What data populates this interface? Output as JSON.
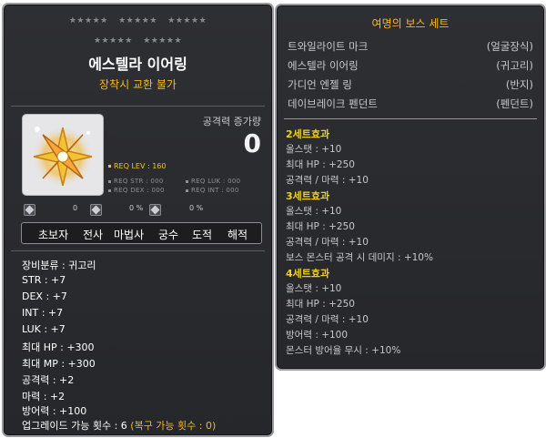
{
  "item": {
    "stars_row1": [
      "★★★★★",
      "★★★★★",
      "★★★★★"
    ],
    "stars_row2": [
      "★★★★★",
      "★★★★★"
    ],
    "name": "에스텔라 이어링",
    "note": "장착시 교환 불가",
    "attack_label": "공격력 증가량",
    "attack_value": "0",
    "req_lev": "REQ LEV : 160",
    "req_str": "REQ STR : 000",
    "req_luk": "REQ LUK : 000",
    "req_dex": "REQ DEX : 000",
    "req_int": "REQ INT : 000",
    "pct_labels": [
      "0",
      "0 %",
      "0 %",
      "0 %"
    ],
    "jobs": [
      "초보자",
      "전사",
      "마법사",
      "궁수",
      "도적",
      "해적"
    ],
    "stats": [
      "장비분류 : 귀고리",
      "STR : +7",
      "DEX : +7",
      "INT : +7",
      "LUK : +7",
      "최대 HP : +300",
      "최대 MP : +300",
      "공격력 : +2",
      "마력 : +2",
      "방어력 : +100"
    ],
    "upgrade_text": "업그레이드 가능 횟수 : 6",
    "upgrade_restore": "(복구 가능 횟수 : 0)"
  },
  "set": {
    "title": "여명의 보스 세트",
    "items": [
      {
        "name": "트와일라이트 마크",
        "category": "(얼굴장식)"
      },
      {
        "name": "에스텔라 이어링",
        "category": "(귀고리)"
      },
      {
        "name": "가디언 엔젤 링",
        "category": "(반지)"
      },
      {
        "name": "데이브레이크 펜던트",
        "category": "(펜던트)"
      }
    ],
    "effects": [
      {
        "header": "2세트효과",
        "lines": [
          "올스탯 : +10",
          "최대 HP : +250",
          "공격력 / 마력 : +10"
        ]
      },
      {
        "header": "3세트효과",
        "lines": [
          "올스탯 : +10",
          "최대 HP : +250",
          "공격력 / 마력 : +10",
          "보스 몬스터 공격 시 데미지 : +10%"
        ]
      },
      {
        "header": "4세트효과",
        "lines": [
          "올스탯 : +10",
          "최대 HP : +250",
          "공격력 / 마력 : +10",
          "방어력 : +100",
          "몬스터 방어율 무시 : +10%"
        ]
      }
    ]
  },
  "colors": {
    "panel_bg": "#2e2f33",
    "gold": "#f4b81e",
    "set_header": "#f0cf1e",
    "muted": "#c8c8cc"
  },
  "icons": [
    "earring-icon",
    "gem-icon",
    "scroll-icon",
    "shield-icon"
  ]
}
